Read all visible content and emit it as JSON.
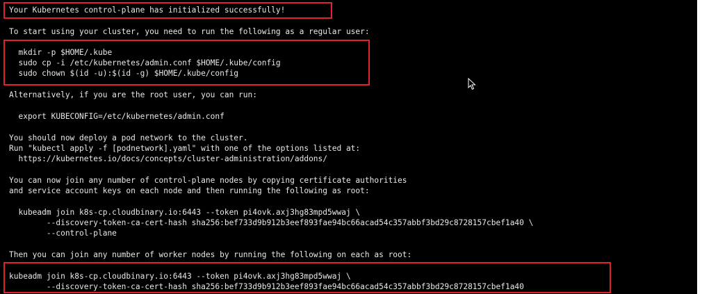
{
  "terminal": {
    "lines": [
      "Your Kubernetes control-plane has initialized successfully!",
      "To start using your cluster, you need to run the following as a regular user:",
      "  mkdir -p $HOME/.kube",
      "  sudo cp -i /etc/kubernetes/admin.conf $HOME/.kube/config",
      "  sudo chown $(id -u):$(id -g) $HOME/.kube/config",
      "Alternatively, if you are the root user, you can run:",
      "  export KUBECONFIG=/etc/kubernetes/admin.conf",
      "You should now deploy a pod network to the cluster.",
      "Run \"kubectl apply -f [podnetwork].yaml\" with one of the options listed at:",
      "  https://kubernetes.io/docs/concepts/cluster-administration/addons/",
      "You can now join any number of control-plane nodes by copying certificate authorities",
      "and service account keys on each node and then running the following as root:",
      "  kubeadm join k8s-cp.cloudbinary.io:6443 --token pi4ovk.axj3hg83mpd5wwaj \\",
      "        --discovery-token-ca-cert-hash sha256:bef733d9b912b3eef893fae94bc66acad54c357abbf3bd29c8728157cbef1a40 \\",
      "        --control-plane",
      "Then you can join any number of worker nodes by running the following on each as root:",
      "kubeadm join k8s-cp.cloudbinary.io:6443 --token pi4ovk.axj3hg83mpd5wwaj \\",
      "        --discovery-token-ca-cert-hash sha256:bef733d9b912b3eef893fae94bc66acad54c357abbf3bd29c8728157cbef1a40"
    ],
    "highlight_color": "#e0232c"
  }
}
